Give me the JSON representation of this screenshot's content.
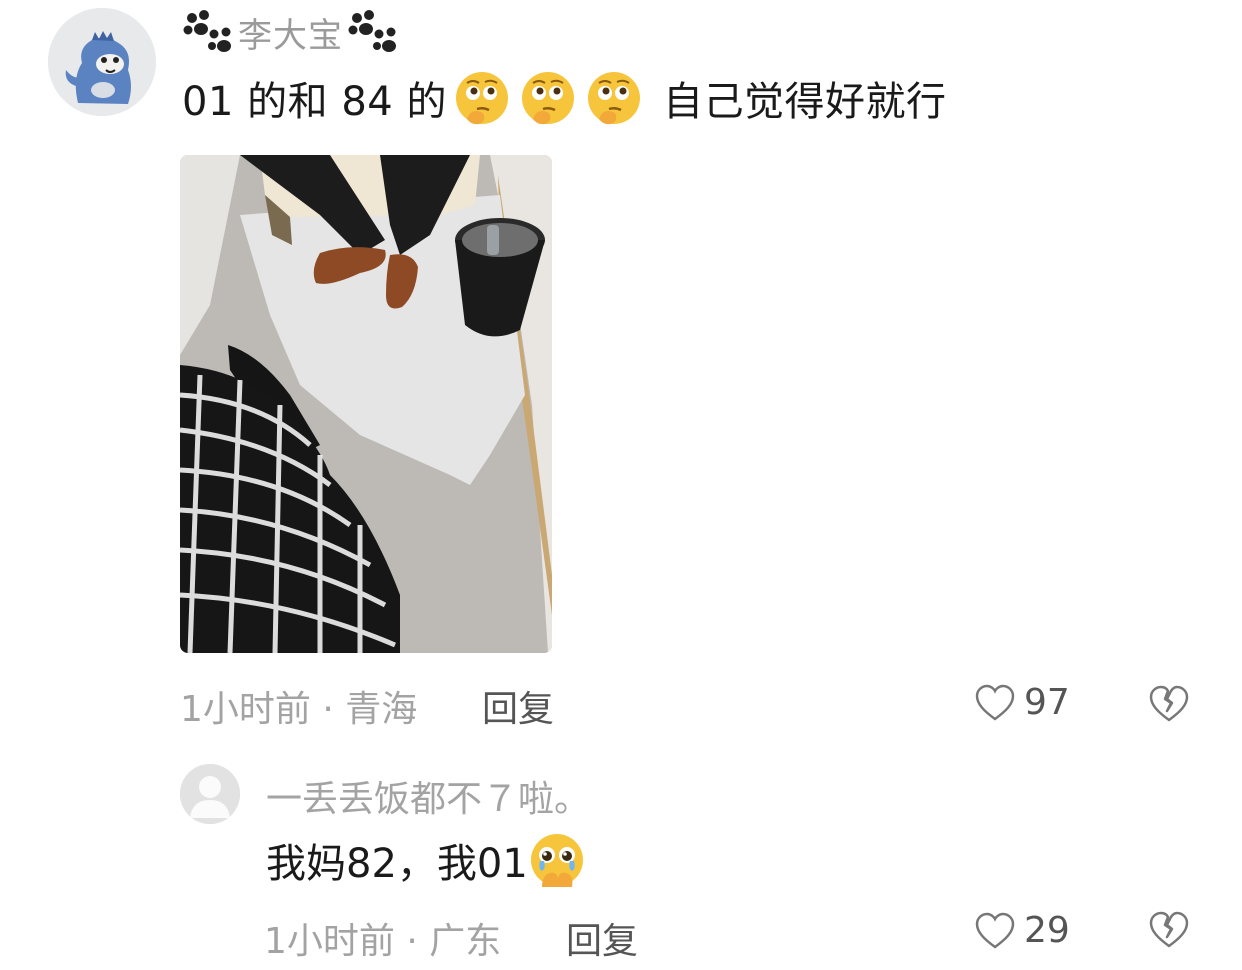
{
  "comment": {
    "author": "李大宝",
    "text_before": "01 的和 84 的",
    "text_after": "自己觉得好就行",
    "emoji_names": [
      "thinking-emoji",
      "thinking-emoji",
      "thinking-emoji"
    ],
    "time_location": "1小时前 · 青海",
    "reply_label": "回复",
    "likes": "97"
  },
  "reply": {
    "author": "一丢丢饭都不７啦。",
    "text": "我妈82，我01",
    "emoji_name": "crying-pleading-emoji",
    "time_location": "1小时前 · 广东",
    "reply_label": "回复",
    "likes": "29"
  },
  "colors": {
    "text": "#1a1a1a",
    "meta": "#a3a3a3",
    "emoji": "#f7c53c"
  }
}
